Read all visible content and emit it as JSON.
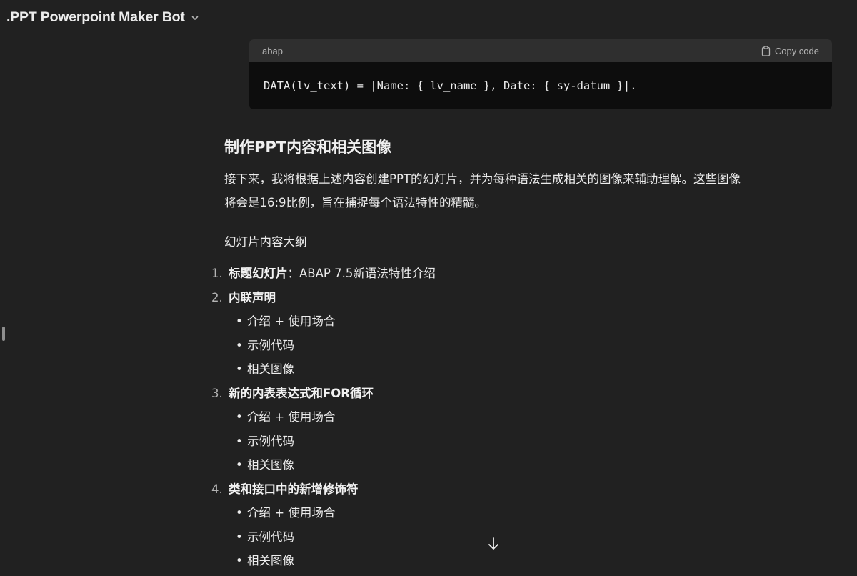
{
  "header": {
    "title": ".PPT Powerpoint Maker Bot"
  },
  "code_block": {
    "language": "abap",
    "copy_label": "Copy code",
    "code": "DATA(lv_text) = |Name: { lv_name }, Date: { sy-datum }|."
  },
  "section": {
    "heading": "制作PPT内容和相关图像",
    "paragraph_line1": "接下来，我将根据上述内容创建PPT的幻灯片，并为每种语法生成相关的图像来辅助理解。这些图像",
    "paragraph_line2": "将会是16:9比例，旨在捕捉每个语法特性的精髓。",
    "outline_label": "幻灯片内容大纲"
  },
  "outline": {
    "item1": {
      "number": "1.",
      "title": "标题幻灯片",
      "suffix": "：ABAP 7.5新语法特性介绍"
    },
    "item2": {
      "number": "2.",
      "title": "内联声明",
      "bullets": [
        "介绍 + 使用场合",
        "示例代码",
        "相关图像"
      ]
    },
    "item3": {
      "number": "3.",
      "title": "新的内表表达式和FOR循环",
      "bullets": [
        "介绍 + 使用场合",
        "示例代码",
        "相关图像"
      ]
    },
    "item4": {
      "number": "4.",
      "title": "类和接口中的新增修饰符",
      "bullets": [
        "介绍 + 使用场合",
        "示例代码",
        "相关图像"
      ]
    }
  },
  "icons": {
    "chevron": "chevron-down-icon",
    "copy": "clipboard-icon",
    "scroll": "arrow-down-icon"
  },
  "colors": {
    "background": "#212121",
    "code_background": "#0d0d0d",
    "code_header": "#2f2f2f",
    "text": "#ececec"
  }
}
